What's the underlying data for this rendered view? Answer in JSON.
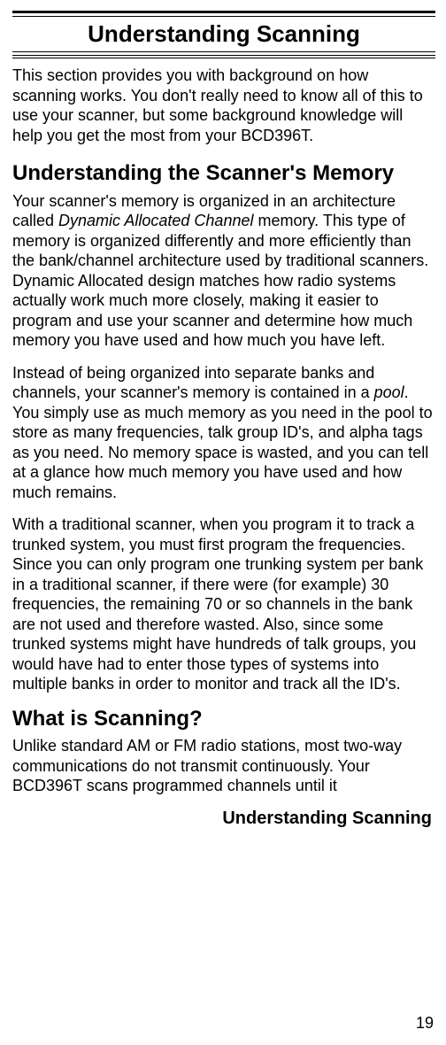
{
  "title": "Understanding Scanning",
  "intro": "This section provides you with background on how scanning works. You don't really need to know all of this to use your scanner, but some background knowledge will help you get the most from your BCD396T.",
  "section1": {
    "heading": "Understanding the Scanner's Memory",
    "para1_pre": "Your scanner's memory is organized in an architecture called ",
    "para1_italic": "Dynamic Allocated Channel",
    "para1_post": " memory. This type of memory is organized differently and more efficiently than the bank/channel architecture used by traditional scanners. Dynamic Allocated design matches how radio systems actually work much more closely, making it easier to program and use your scanner and determine how much memory you have used and how much you have left.",
    "para2_pre": "Instead of being organized into separate banks and channels, your scanner's memory is contained in a ",
    "para2_italic": "pool",
    "para2_post": ". You simply use as much memory as you need in the pool to store as many frequencies, talk group ID's, and alpha tags as you need. No memory space is wasted, and you can tell at a glance how much memory you have used and how much remains.",
    "para3": "With a traditional scanner, when you program it to track a trunked system, you must first program the frequencies. Since you can only program one trunking system per bank in a traditional scanner, if there were (for example) 30 frequencies, the remaining 70 or so channels in the bank are not used and therefore wasted. Also, since some trunked systems might have hundreds of talk groups, you would have had to enter those types of systems into multiple banks in order to monitor and track all the ID's."
  },
  "section2": {
    "heading": "What is Scanning?",
    "para1": "Unlike standard AM or FM radio stations, most two-way communications do not transmit continuously. Your BCD396T scans programmed channels until it"
  },
  "footer_title": "Understanding Scanning",
  "page_number": "19"
}
